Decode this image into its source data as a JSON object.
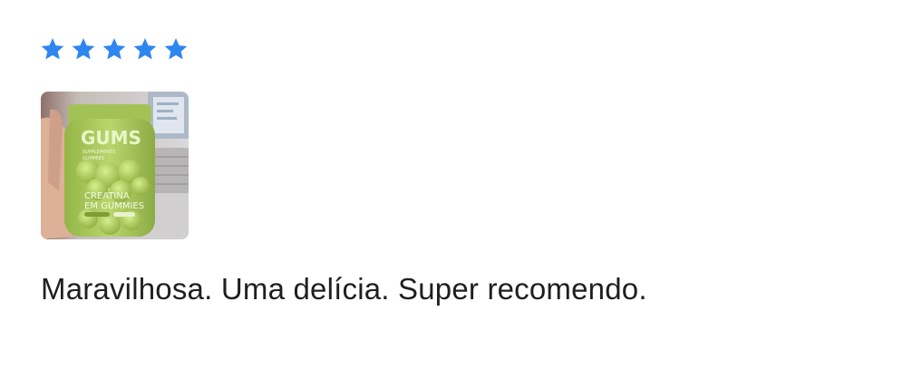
{
  "review": {
    "rating": 5,
    "rating_max": 5,
    "star_color": "#2e86f0",
    "photo": {
      "icon": "product-photo-gummies-jar",
      "label_brand": "GUMS",
      "label_sub_1": "SUPPLEMENTS",
      "label_sub_2": "GUMMIES",
      "label_product_1": "CREATINA",
      "label_product_2": "EM GUMMIES"
    },
    "text": "Maravilhosa. Uma delícia. Super recomendo."
  }
}
